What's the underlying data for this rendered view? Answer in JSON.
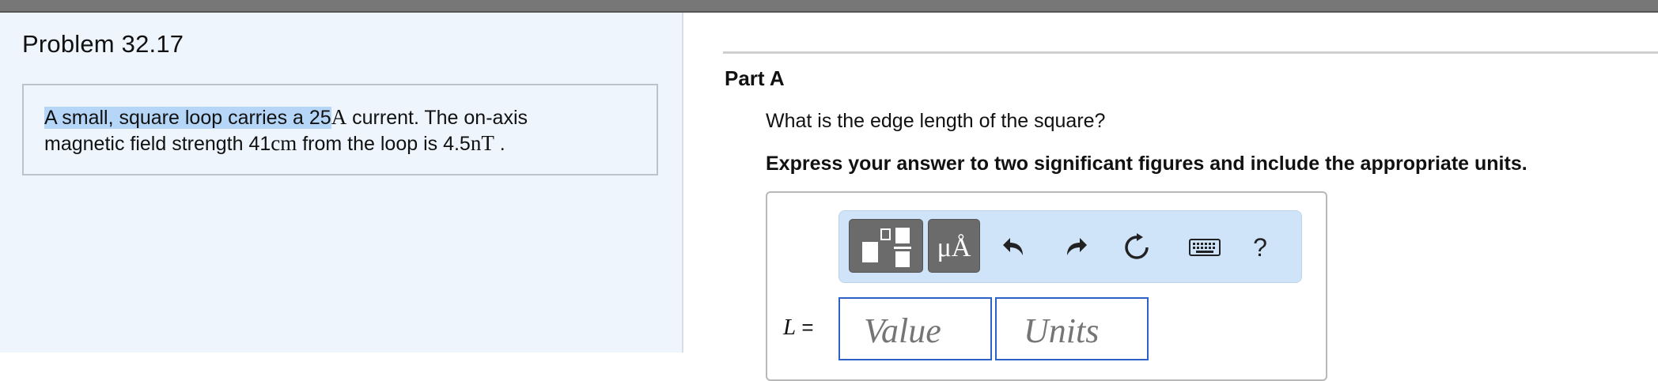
{
  "problem": {
    "title": "Problem 32.17",
    "text_highlighted": "A small, square loop carries a 25",
    "current_unit": "A",
    "text_after_current": " current. The on-axis",
    "text_line2_start": "magnetic field strength 41",
    "distance_unit": "cm",
    "text_from_loop": " from the loop is 4.5",
    "field_unit": "nT",
    "text_end": " ."
  },
  "part": {
    "label": "Part A",
    "question": "What is the edge length of the square?",
    "instruction": "Express your answer to two significant figures and include the appropriate units."
  },
  "toolbar": {
    "units_button": "μÅ",
    "help_label": "?",
    "icons": [
      "templates-icon",
      "units-icon",
      "undo-icon",
      "redo-icon",
      "reset-icon",
      "keyboard-icon",
      "help-icon"
    ]
  },
  "answer": {
    "variable": "L",
    "equals": " =",
    "value_placeholder": "Value",
    "units_placeholder": "Units"
  },
  "colors": {
    "left_pane_bg": "#eef5fd",
    "toolbar_bg": "#cfe4f8",
    "field_border": "#2d63c7",
    "highlight": "#b6d6f7"
  }
}
